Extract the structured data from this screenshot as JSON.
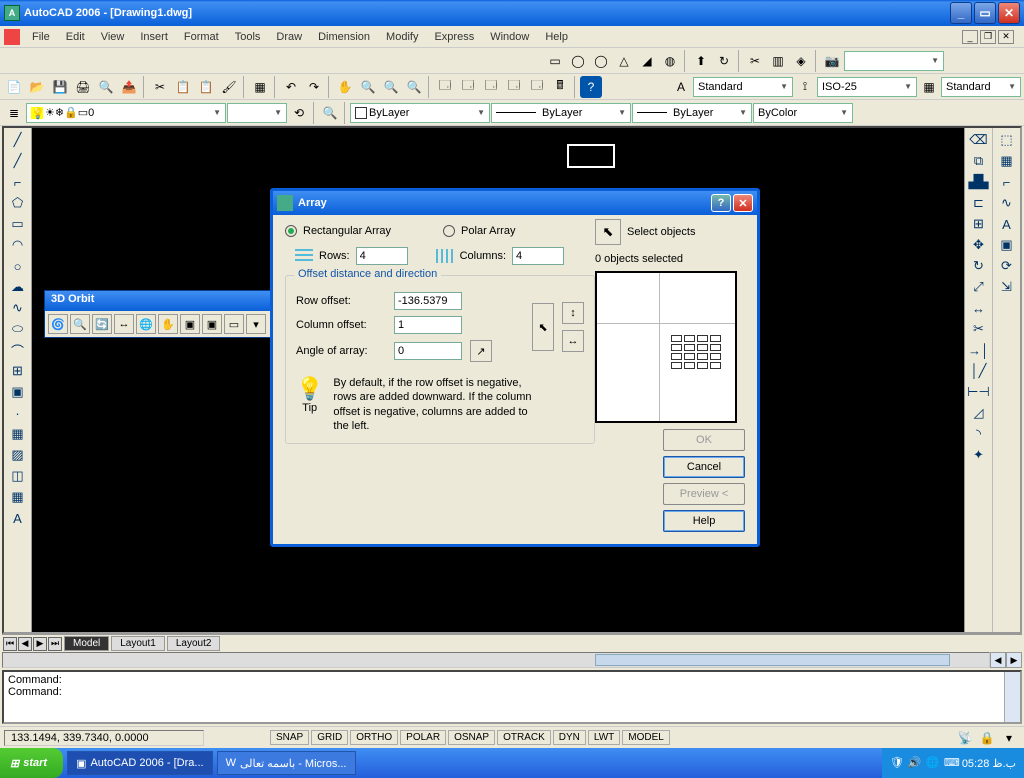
{
  "title": "AutoCAD 2006 - [Drawing1.dwg]",
  "menu": [
    "File",
    "Edit",
    "View",
    "Insert",
    "Format",
    "Tools",
    "Draw",
    "Dimension",
    "Modify",
    "Express",
    "Window",
    "Help"
  ],
  "styles": {
    "text": "Standard",
    "dim": "ISO-25",
    "table": "Standard"
  },
  "layer": {
    "current": "0",
    "linetype": "ByLayer",
    "lineweight": "ByLayer",
    "color": "ByLayer",
    "plotcolor": "ByColor"
  },
  "orbit": {
    "title": "3D Orbit"
  },
  "dialog": {
    "title": "Array",
    "mode_rect": "Rectangular Array",
    "mode_polar": "Polar Array",
    "select_objects": "Select objects",
    "objects_selected": "0 objects selected",
    "rows_label": "Rows:",
    "rows": "4",
    "cols_label": "Columns:",
    "cols": "4",
    "group_title": "Offset distance and direction",
    "row_offset_label": "Row offset:",
    "row_offset": "-136.5379",
    "col_offset_label": "Column offset:",
    "col_offset": "1",
    "angle_label": "Angle of array:",
    "angle": "0",
    "tip_label": "Tip",
    "tip_text": "By default, if the row offset is negative, rows are added downward.  If the column offset is negative, columns are added to the left.",
    "ok": "OK",
    "cancel": "Cancel",
    "preview": "Preview <",
    "help": "Help"
  },
  "tabs": {
    "model": "Model",
    "l1": "Layout1",
    "l2": "Layout2"
  },
  "cmd": {
    "l1": "Command:",
    "l2": "Command:"
  },
  "status": {
    "coords": "133.1494, 339.7340, 0.0000",
    "buttons": [
      "SNAP",
      "GRID",
      "ORTHO",
      "POLAR",
      "OSNAP",
      "OTRACK",
      "DYN",
      "LWT",
      "MODEL"
    ]
  },
  "taskbar": {
    "start": "start",
    "tasks": [
      "AutoCAD 2006 - [Dra...",
      "باسمه تعالی - Micros..."
    ],
    "time": "05:28 ب.ظ"
  }
}
